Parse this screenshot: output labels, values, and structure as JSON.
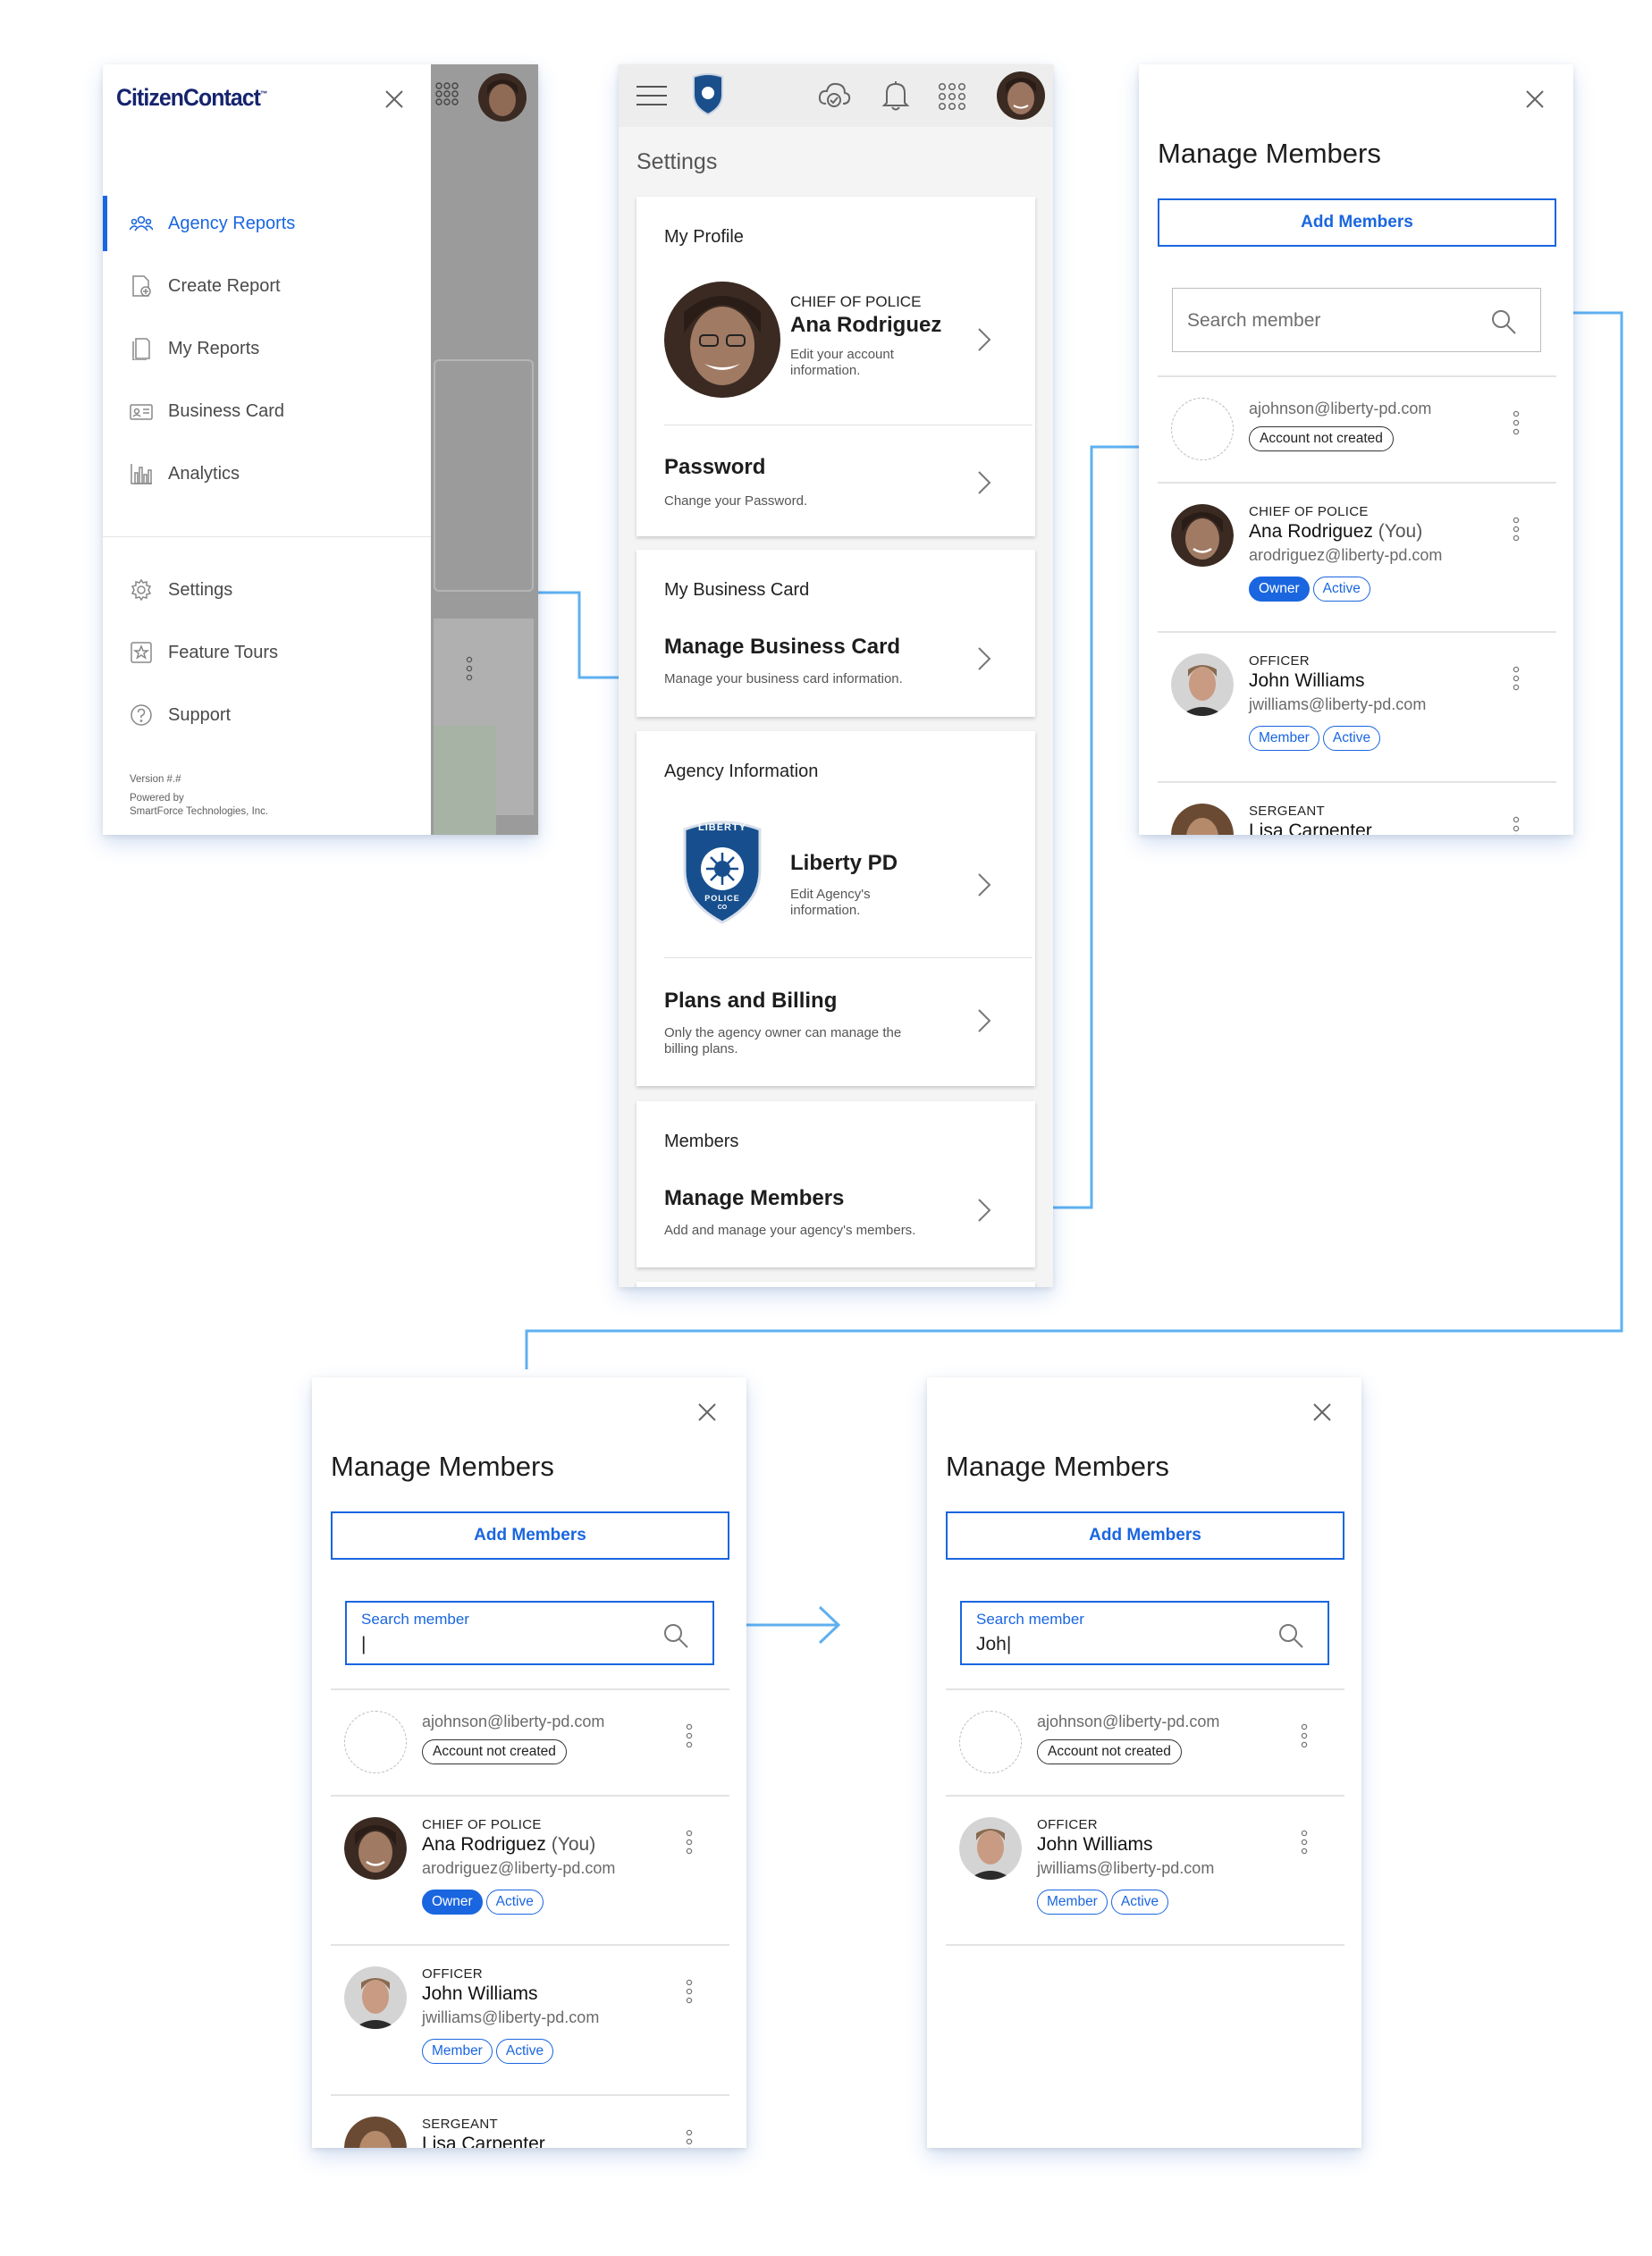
{
  "drawer": {
    "brand": "CitizenContact",
    "brand_tm": "™",
    "items": [
      {
        "label": "Agency Reports",
        "icon": "people-icon"
      },
      {
        "label": "Create Report",
        "icon": "create-report-icon"
      },
      {
        "label": "My Reports",
        "icon": "reports-icon"
      },
      {
        "label": "Business Card",
        "icon": "business-card-icon"
      },
      {
        "label": "Analytics",
        "icon": "analytics-icon"
      }
    ],
    "bottom_items": [
      {
        "label": "Settings",
        "icon": "gear-icon"
      },
      {
        "label": "Feature Tours",
        "icon": "star-icon"
      },
      {
        "label": "Support",
        "icon": "help-icon"
      }
    ],
    "version": "Version #.#",
    "powered_by": "Powered by",
    "company": "SmartForce Technologies, Inc."
  },
  "settings": {
    "title": "Settings",
    "my_profile": {
      "heading": "My Profile",
      "rank": "CHIEF OF POLICE",
      "name": "Ana Rodriguez",
      "sub_line1": "Edit your account",
      "sub_line2": "information."
    },
    "password": {
      "title": "Password",
      "sub": "Change your Password."
    },
    "business_card": {
      "heading": "My Business Card",
      "title": "Manage Business Card",
      "sub": "Manage your business card information."
    },
    "agency": {
      "heading": "Agency Information",
      "name": "Liberty PD",
      "sub_line1": "Edit Agency's",
      "sub_line2": "information.",
      "badge_top": "LIBERTY",
      "badge_bottom": "POLICE",
      "badge_co": "CO"
    },
    "billing": {
      "title": "Plans and Billing",
      "sub_line1": "Only the agency owner can manage the",
      "sub_line2": "billing plans."
    },
    "members": {
      "heading": "Members",
      "title": "Manage Members",
      "sub": "Add and manage your agency's members."
    }
  },
  "manage_members": {
    "title": "Manage Members",
    "add_button": "Add Members",
    "search_placeholder": "Search member",
    "search_label": "Search member",
    "search_value_empty": "|",
    "search_value_typed": "Joh|",
    "members": [
      {
        "email": "ajohnson@liberty-pd.com",
        "status": "Account not created"
      },
      {
        "rank": "CHIEF OF POLICE",
        "name": "Ana Rodriguez",
        "you": "(You)",
        "email": "arodriguez@liberty-pd.com",
        "role": "Owner",
        "status": "Active"
      },
      {
        "rank": "OFFICER",
        "name": "John Williams",
        "email": "jwilliams@liberty-pd.com",
        "role": "Member",
        "status": "Active"
      },
      {
        "rank": "SERGEANT",
        "name": "Lisa Carpenter"
      }
    ]
  },
  "colors": {
    "accent": "#1a66e0",
    "connector": "#5fb0f0",
    "brand_navy": "#15246e"
  }
}
